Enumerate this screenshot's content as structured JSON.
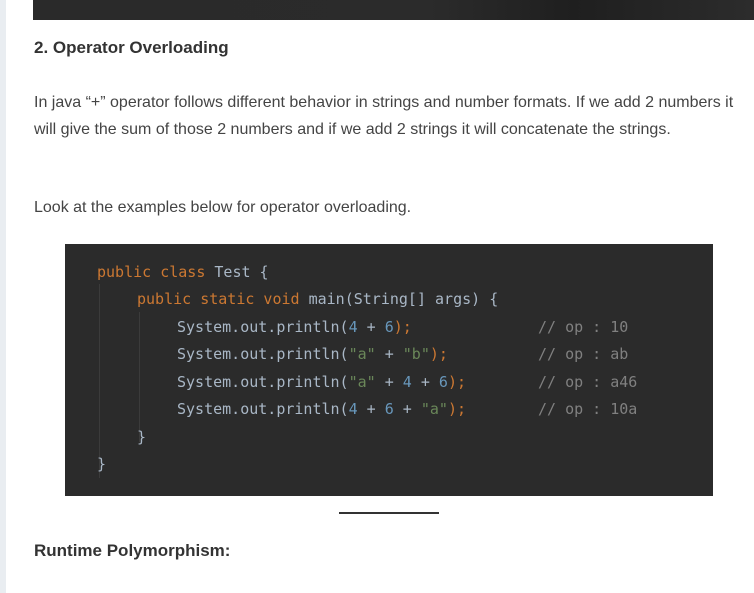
{
  "section": {
    "heading": "2. Operator Overloading",
    "paragraph_1": "In java “+” operator follows different behavior in strings and number formats. If we add 2 numbers it will give the sum of those 2 numbers and if we add 2 strings it will concatenate the strings.",
    "paragraph_2": "Look at the examples below for operator overloading."
  },
  "code": {
    "line1": {
      "kw": "public class",
      "rest": " Test {"
    },
    "line2": {
      "kw": "public static void",
      "rest": " main(String[] args) {"
    },
    "line3": {
      "pre": "System.out.println(",
      "a": "4",
      "op": " + ",
      "b": "6",
      "end": ");",
      "comment": "// op : 10"
    },
    "line4": {
      "pre": "System.out.println(",
      "a": "\"a\"",
      "op": " + ",
      "b": "\"b\"",
      "end": ");",
      "comment": "// op : ab"
    },
    "line5": {
      "pre": "System.out.println(",
      "a": "\"a\"",
      "op1": " + ",
      "b": "4",
      "op2": " + ",
      "c": "6",
      "end": ");",
      "comment": "// op : a46"
    },
    "line6": {
      "pre": "System.out.println(",
      "a": "4",
      "op1": " + ",
      "b": "6",
      "op2": " + ",
      "c": "\"a\"",
      "end": ");",
      "comment": "// op : 10a"
    },
    "line7": "}",
    "line8": "}"
  },
  "next_section": {
    "heading": "Runtime Polymorphism:"
  }
}
